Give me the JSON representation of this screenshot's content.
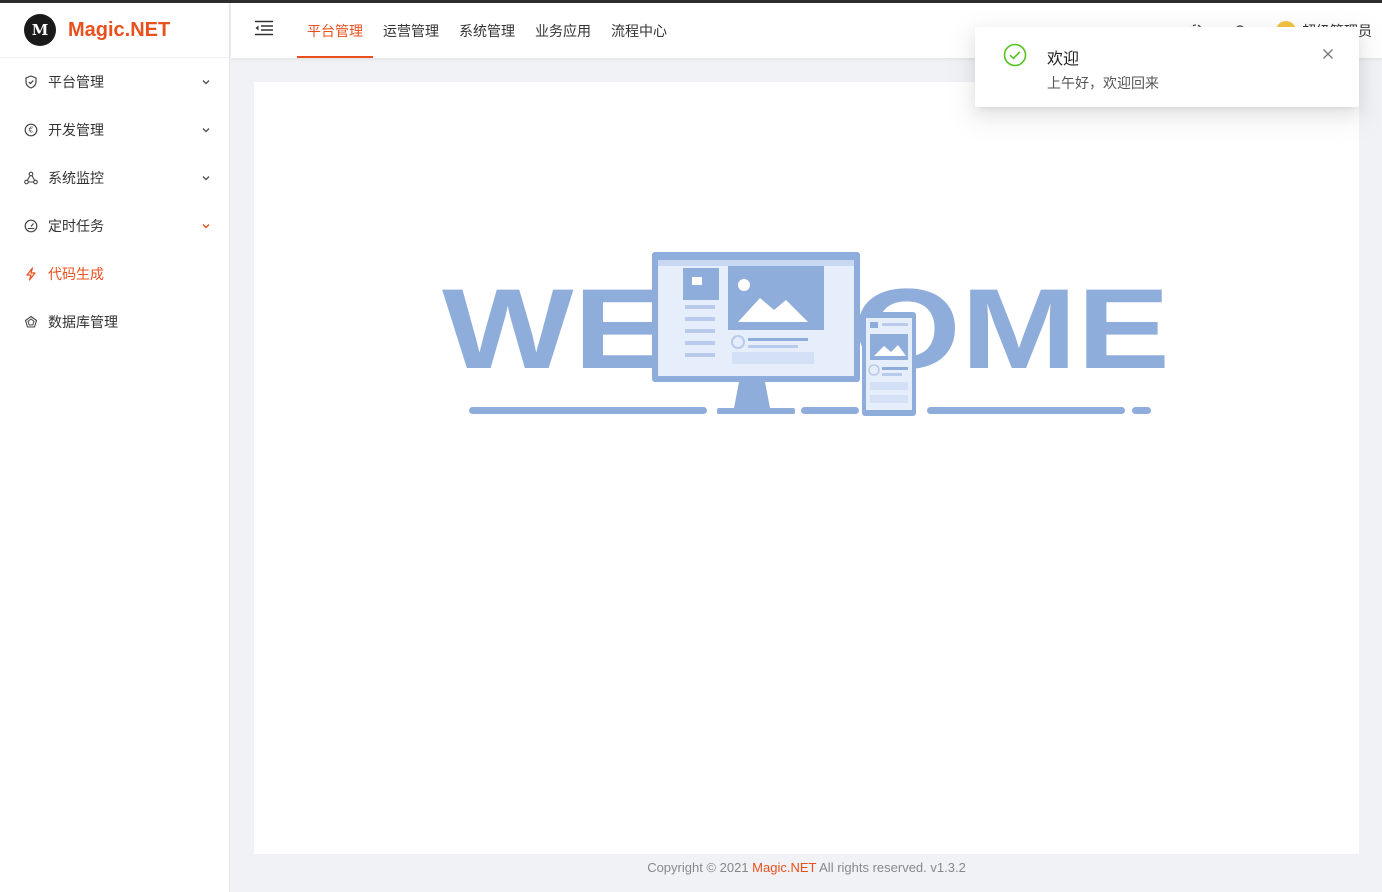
{
  "brand": {
    "logo_text": "M",
    "title": "Magic.NET"
  },
  "sidebar": {
    "items": [
      {
        "label": "平台管理",
        "icon": "shield-icon",
        "has_arrow": true
      },
      {
        "label": "开发管理",
        "icon": "euro-circle-icon",
        "has_arrow": true
      },
      {
        "label": "系统监控",
        "icon": "cluster-icon",
        "has_arrow": true
      },
      {
        "label": "定时任务",
        "icon": "dashboard-icon",
        "has_arrow": true
      },
      {
        "label": "代码生成",
        "icon": "thunderbolt-icon",
        "has_arrow": false
      },
      {
        "label": "数据库管理",
        "icon": "database-icon",
        "has_arrow": false
      }
    ]
  },
  "header": {
    "tabs": [
      {
        "label": "平台管理",
        "active": true
      },
      {
        "label": "运营管理",
        "active": false
      },
      {
        "label": "系统管理",
        "active": false
      },
      {
        "label": "业务应用",
        "active": false
      },
      {
        "label": "流程中心",
        "active": false
      }
    ],
    "user_name": "超级管理员"
  },
  "welcome": {
    "text": "WELCOME"
  },
  "footer": {
    "prefix": "Copyright © 2021 ",
    "brand": "Magic.NET",
    "suffix": " All rights reserved. v1.3.2"
  },
  "notification": {
    "title": "欢迎",
    "message": "上午好，欢迎回来"
  },
  "colors": {
    "accent": "#e8501e",
    "welcome_blue": "#8fadda",
    "success": "#52c41a"
  }
}
